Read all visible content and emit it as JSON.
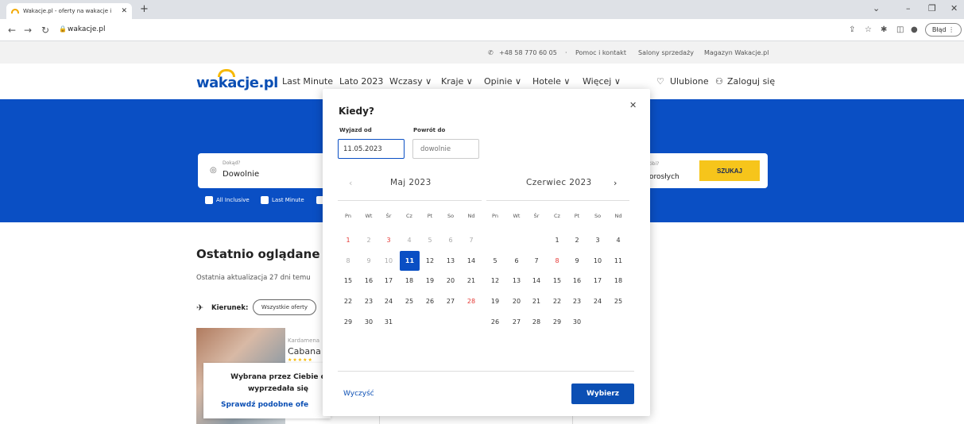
{
  "browser": {
    "tab_title": "Wakacje.pl - oferty na wakacje i ",
    "url": "wakacje.pl",
    "error_label": "Błąd"
  },
  "topbar": {
    "phone": "+48 58 770 60 05",
    "help": "Pomoc i kontakt",
    "salons": "Salony sprzedaży",
    "magazine": "Magazyn Wakacje.pl"
  },
  "nav": {
    "logo": "wakacje.pl",
    "items": [
      "Last Minute",
      "Lato 2023",
      "Wczasy ∨",
      "Kraje ∨",
      "Opinie ∨",
      "Hotele ∨",
      "Więcej ∨"
    ],
    "favorites": "Ulubione",
    "login": "Zaloguj się"
  },
  "search": {
    "where_label": "Dokąd?",
    "where_value": "Dowolnie",
    "who_label": "óbi?",
    "who_value": "orosłych",
    "button": "SZUKAJ",
    "filters": [
      "All Inclusive",
      "Last Minute"
    ]
  },
  "recent": {
    "title": "Ostatnio oglądane",
    "subtitle": "Ostatnia aktualizacja 27 dni temu",
    "direction_label": "Kierunek:",
    "all_offers": "Wszystkie oferty",
    "card": {
      "location": "Kardamena",
      "name": "Cabana",
      "stars": "★★★★★",
      "sold_text": "Wybrana przez Ciebie o wyprzedała się",
      "link": "Sprawdź podobne ofe"
    }
  },
  "datepicker": {
    "title": "Kiedy?",
    "depart_label": "Wyjazd od",
    "depart_value": "11.05.2023",
    "return_label": "Powrót do",
    "return_placeholder": "dowolnie",
    "month_left": "Maj 2023",
    "month_right": "Czerwiec 2023",
    "weekdays": [
      "Pn",
      "Wt",
      "Śr",
      "Cz",
      "Pt",
      "So",
      "Nd"
    ],
    "selected_day": "11",
    "clear": "Wyczyść",
    "choose": "Wybierz"
  }
}
